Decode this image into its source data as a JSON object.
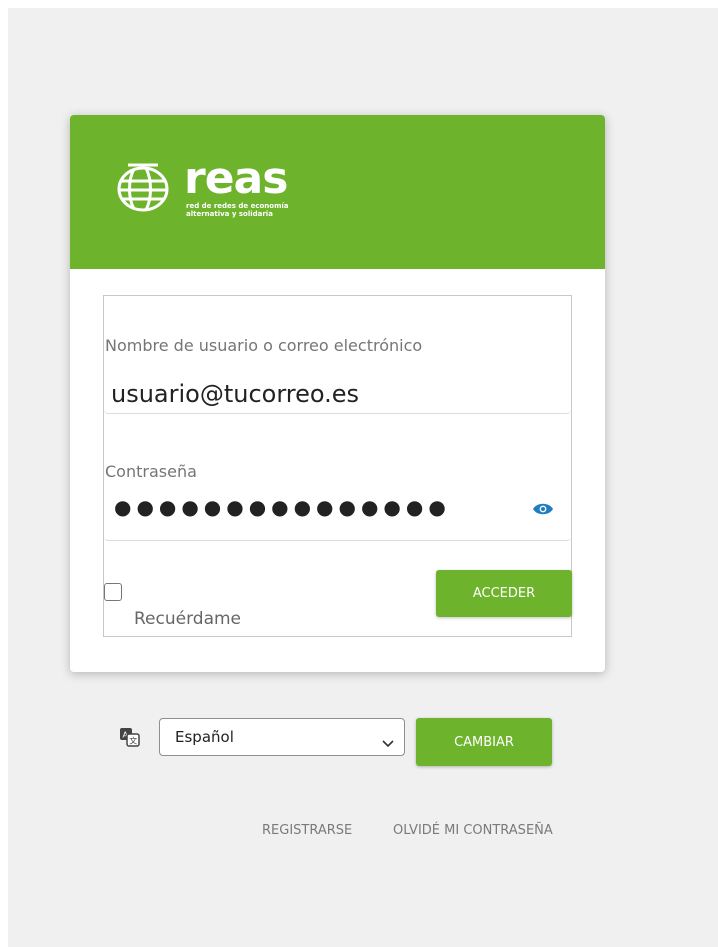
{
  "brand": {
    "name": "reas",
    "tagline_line1": "red de redes de economía",
    "tagline_line2": "alternativa y solidaria",
    "color": "#6db32c"
  },
  "login": {
    "username_label": "Nombre de usuario o correo electrónico",
    "username_value": "usuario@tucorreo.es",
    "password_label": "Contraseña",
    "password_masked": "●●●●●●●●●●●●●●●",
    "show_password_icon": "eye-icon",
    "remember_label": "Recuérdame",
    "remember_checked": false,
    "submit_label": "ACCEDER"
  },
  "language": {
    "icon": "translate-icon",
    "selected": "Español",
    "button_label": "CAMBIAR"
  },
  "links": {
    "register": "REGISTRARSE",
    "forgot_password": "OLVIDÉ MI CONTRASEÑA"
  }
}
